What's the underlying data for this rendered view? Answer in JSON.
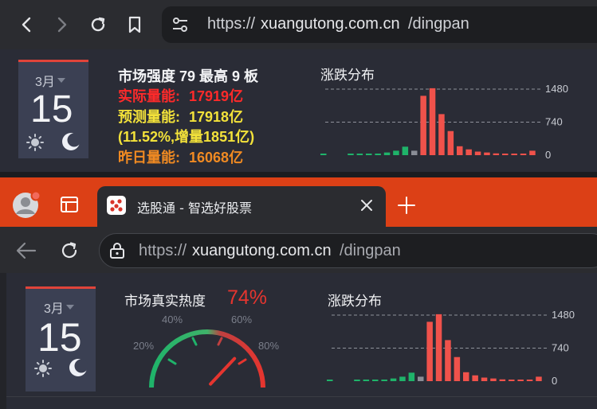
{
  "top_browser": {
    "url": {
      "prefix": "https://",
      "host": "xuangutong.com.cn",
      "path": "/dingpan"
    }
  },
  "top_panel": {
    "date": {
      "month": "3月",
      "day": "15"
    },
    "stats": {
      "strength": "市场强度 79 最高 9 板",
      "actual_label": "实际量能:",
      "actual_value": "17919亿",
      "forecast_label": "预测量能:",
      "forecast_value": "17918亿",
      "forecast_change": "(11.52%,增量1851亿)",
      "yesterday_label": "昨日量能:",
      "yesterday_value": "16068亿"
    },
    "chart_title": "涨跌分布"
  },
  "bottom_browser": {
    "tab_title": "选股通 - 智选好股票",
    "url": {
      "prefix": "https://",
      "host": "xuangutong.com.cn",
      "path": "/dingpan"
    }
  },
  "bottom_panel": {
    "date": {
      "month": "3月",
      "day": "15"
    },
    "heat_label": "市场真实热度",
    "heat_value": "74%",
    "chart_title": "涨跌分布"
  },
  "gauge": {
    "value": 74,
    "ticks": [
      "20%",
      "40%",
      "60%",
      "80%"
    ]
  },
  "colors": {
    "up": "#f0524b",
    "down": "#1fb36a",
    "flat": "#8a8d96",
    "accent": "#dc4016",
    "actual": "#ff2a2a",
    "forecast": "#f3e23a",
    "yesterday": "#f08a22"
  },
  "chart_data": [
    {
      "type": "bar",
      "title": "涨跌分布",
      "yticks": [
        0,
        740,
        1480
      ],
      "ylim": [
        0,
        1480
      ],
      "values": [
        10,
        0,
        0,
        10,
        15,
        20,
        30,
        60,
        100,
        190,
        100,
        1330,
        1500,
        920,
        540,
        200,
        130,
        80,
        60,
        40,
        30,
        10,
        30,
        100
      ],
      "colors": [
        "down",
        "none",
        "none",
        "down",
        "down",
        "down",
        "down",
        "down",
        "down",
        "down",
        "flat",
        "up",
        "up",
        "up",
        "up",
        "up",
        "up",
        "up",
        "up",
        "up",
        "up",
        "up",
        "up",
        "up"
      ]
    },
    {
      "type": "bar",
      "title": "涨跌分布",
      "yticks": [
        0,
        740,
        1480
      ],
      "ylim": [
        0,
        1480
      ],
      "values": [
        10,
        0,
        0,
        10,
        15,
        20,
        30,
        60,
        100,
        190,
        100,
        1330,
        1500,
        920,
        540,
        200,
        130,
        80,
        60,
        40,
        30,
        10,
        30,
        100
      ],
      "colors": [
        "down",
        "none",
        "none",
        "down",
        "down",
        "down",
        "down",
        "down",
        "down",
        "down",
        "flat",
        "up",
        "up",
        "up",
        "up",
        "up",
        "up",
        "up",
        "up",
        "up",
        "up",
        "up",
        "up",
        "up"
      ]
    }
  ]
}
